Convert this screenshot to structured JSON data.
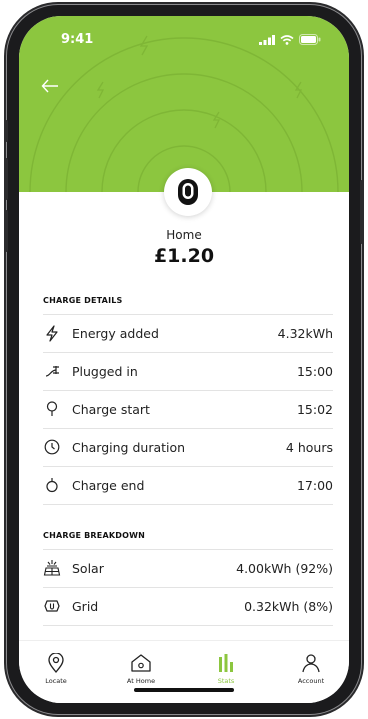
{
  "status_bar": {
    "time": "9:41"
  },
  "header": {
    "location_name": "Home",
    "amount": "£1.20"
  },
  "charge_details": {
    "title": "CHARGE DETAILS",
    "rows": [
      {
        "icon": "lightning-icon",
        "label": "Energy added",
        "value": "4.32kWh"
      },
      {
        "icon": "plug-icon",
        "label": "Plugged in",
        "value": "15:00"
      },
      {
        "icon": "location-pin-icon",
        "label": "Charge start",
        "value": "15:02"
      },
      {
        "icon": "clock-icon",
        "label": "Charging duration",
        "value": "4 hours"
      },
      {
        "icon": "charge-end-icon",
        "label": "Charge end",
        "value": "17:00"
      }
    ]
  },
  "charge_breakdown": {
    "title": "CHARGE BREAKDOWN",
    "rows": [
      {
        "icon": "solar-panel-icon",
        "label": "Solar",
        "value": "4.00kWh (92%)"
      },
      {
        "icon": "grid-icon",
        "label": "Grid",
        "value": "0.32kWh (8%)"
      }
    ]
  },
  "bottom_nav": {
    "items": [
      {
        "icon": "location-pin-icon",
        "label": "Locate"
      },
      {
        "icon": "home-icon",
        "label": "At Home"
      },
      {
        "icon": "stats-icon",
        "label": "Stats",
        "active": true
      },
      {
        "icon": "account-icon",
        "label": "Account"
      }
    ]
  },
  "colors": {
    "accent": "#8cc63f",
    "text": "#222222",
    "divider": "#e3e3e3"
  }
}
